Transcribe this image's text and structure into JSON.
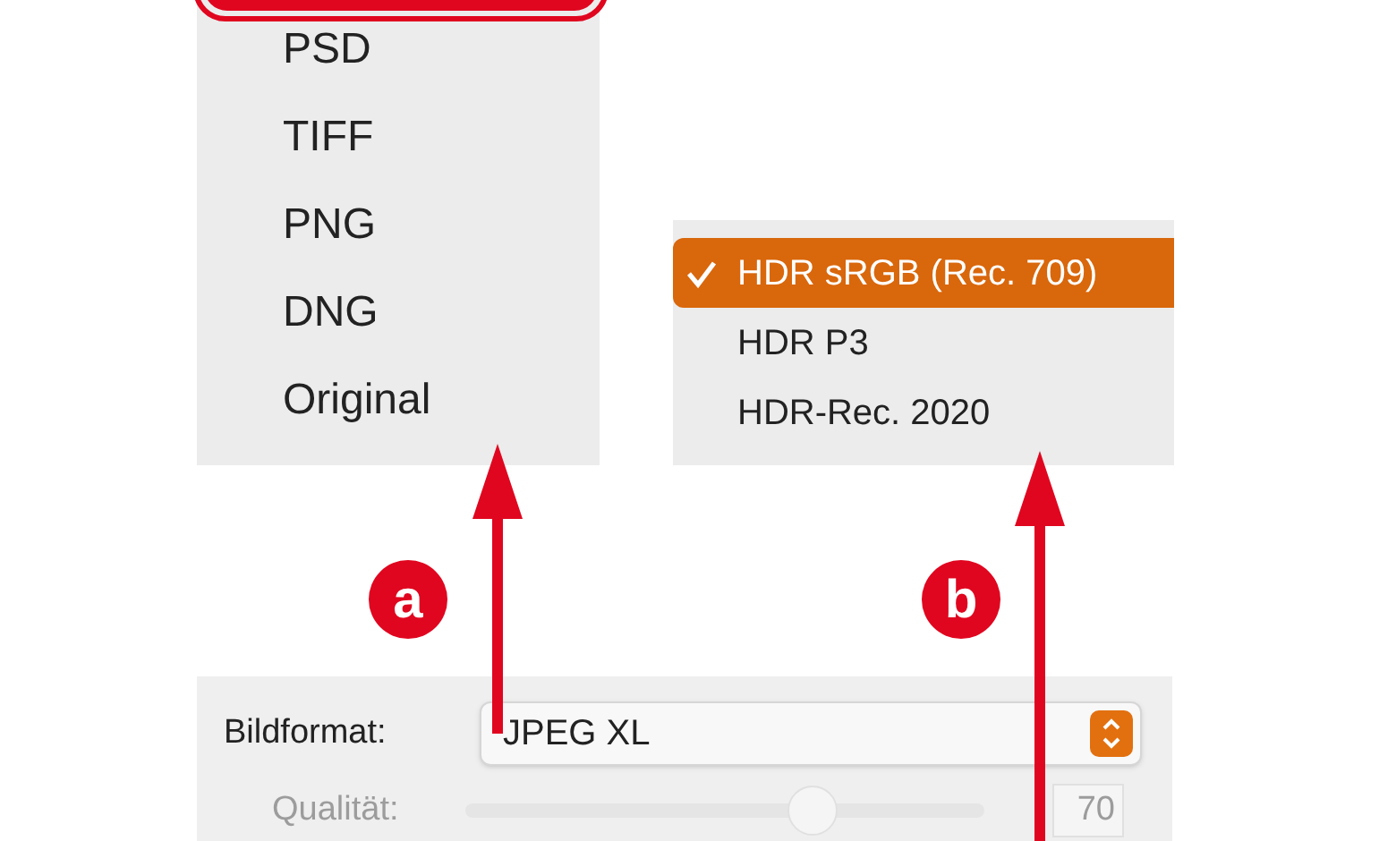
{
  "format_menu": {
    "items": [
      {
        "label": "PSD",
        "selected": false
      },
      {
        "label": "TIFF",
        "selected": false
      },
      {
        "label": "PNG",
        "selected": false
      },
      {
        "label": "DNG",
        "selected": false
      },
      {
        "label": "Original",
        "selected": false
      }
    ]
  },
  "hdr_menu": {
    "items": [
      {
        "label": "HDR sRGB (Rec. 709)",
        "selected": true
      },
      {
        "label": "HDR P3",
        "selected": false
      },
      {
        "label": "HDR-Rec. 2020",
        "selected": false
      }
    ]
  },
  "annotations": [
    {
      "label": "a"
    },
    {
      "label": "b"
    }
  ],
  "settings": {
    "format": {
      "label": "Bildformat:",
      "value": "JPEG XL"
    },
    "quality": {
      "label": "Qualität:",
      "level": 0.67,
      "value": "70",
      "disabled": true
    }
  }
}
